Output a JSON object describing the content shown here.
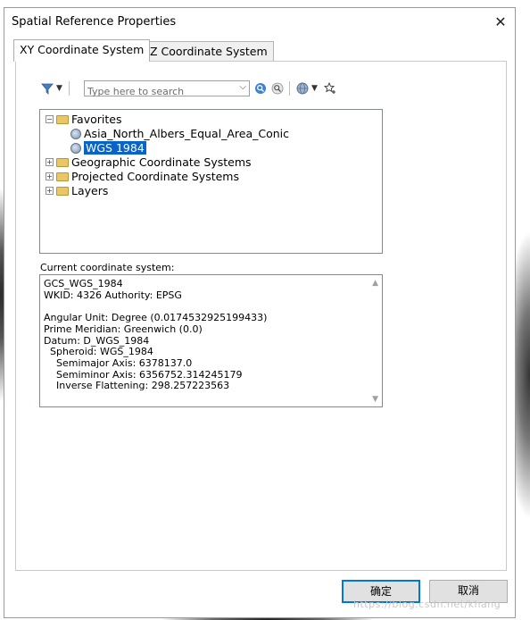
{
  "window": {
    "title": "Spatial Reference Properties",
    "close_glyph": "✕"
  },
  "tabs": [
    {
      "label": "XY Coordinate System",
      "active": true
    },
    {
      "label": "Z Coordinate System",
      "active": false
    }
  ],
  "toolbar": {
    "search_placeholder": "Type here to search",
    "icons": [
      "filter-icon",
      "search-icon",
      "clear-search-icon",
      "globe-icon",
      "add-favorite-icon"
    ]
  },
  "tree": {
    "favorites_label": "Favorites",
    "favorites_items": [
      "Asia_North_Albers_Equal_Area_Conic",
      "WGS 1984"
    ],
    "selected": "WGS 1984",
    "roots": [
      "Geographic Coordinate Systems",
      "Projected Coordinate Systems",
      "Layers"
    ]
  },
  "details": {
    "label": "Current coordinate system:",
    "text": "GCS_WGS_1984\nWKID: 4326 Authority: EPSG\n\nAngular Unit: Degree (0.0174532925199433)\nPrime Meridian: Greenwich (0.0)\nDatum: D_WGS_1984\n  Spheroid: WGS_1984\n    Semimajor Axis: 6378137.0\n    Semiminor Axis: 6356752.314245179\n    Inverse Flattening: 298.257223563"
  },
  "buttons": {
    "ok": "确定",
    "cancel": "取消"
  },
  "watermark": "https://blog.csdn.net/khang",
  "colors": {
    "selection": "#0a63c9",
    "default_button_border": "#0078d7"
  }
}
